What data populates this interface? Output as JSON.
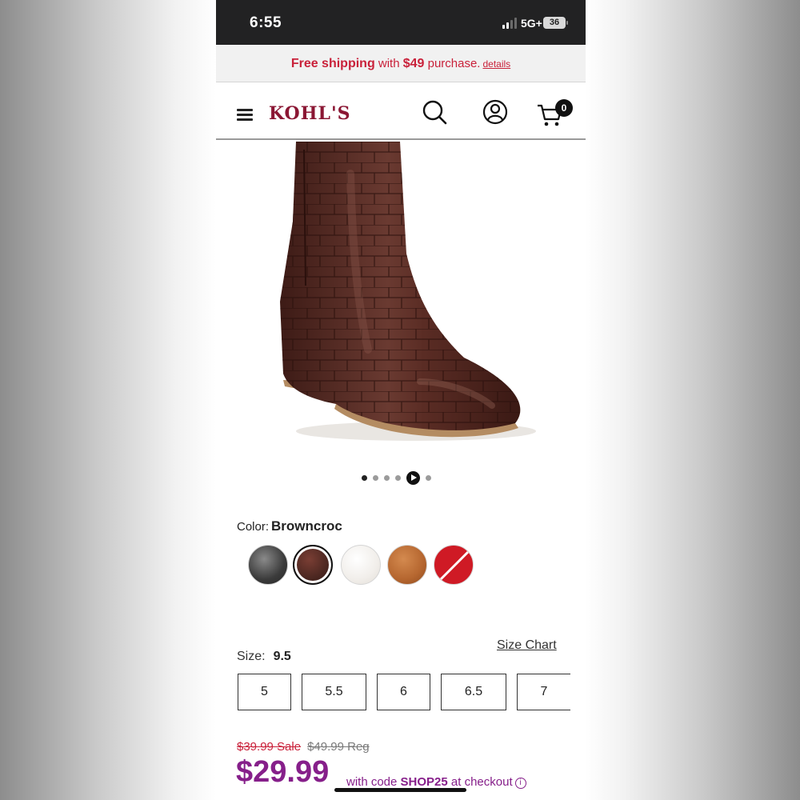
{
  "status_bar": {
    "time": "6:55",
    "network": "5G+",
    "battery": "36"
  },
  "promo": {
    "prefix": "Free shipping",
    "middle": " with ",
    "amount": "$49",
    "suffix": " purchase.",
    "details_link": "details"
  },
  "header": {
    "logo": "KOHL'S",
    "cart_count": "0"
  },
  "carousel": {
    "slide_count": 6,
    "active_index": 0,
    "video_index": 4
  },
  "color": {
    "label": "Color:",
    "value": "Browncroc",
    "swatches": [
      {
        "name": "Black croc",
        "color": "#3b3b3b"
      },
      {
        "name": "Browncroc",
        "color": "#4a2620"
      },
      {
        "name": "White",
        "color": "#f3f1ee"
      },
      {
        "name": "Cognac",
        "color": "#b5662f"
      },
      {
        "name": "Red",
        "color": "#cf1a25"
      }
    ]
  },
  "size": {
    "label": "Size:",
    "value": "9.5",
    "chart_link": "Size Chart",
    "options": [
      "5",
      "5.5",
      "6",
      "6.5",
      "7"
    ]
  },
  "price": {
    "sale_old": "$39.99 Sale",
    "regular": "$49.99 Reg",
    "current": "$29.99",
    "code_prefix": "with code ",
    "code": "SHOP25",
    "code_suffix": " at checkout"
  }
}
